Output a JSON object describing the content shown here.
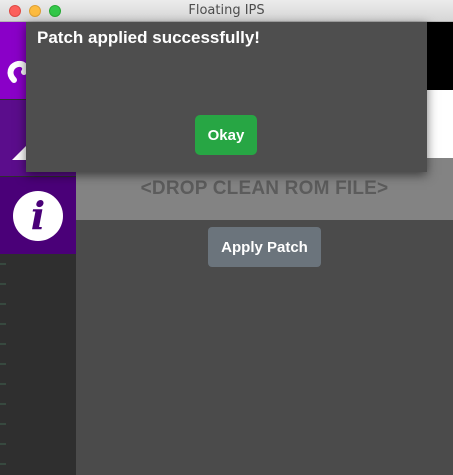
{
  "window": {
    "title": "Floating IPS"
  },
  "sidebar": {
    "items": [
      {
        "name": "apply-patch",
        "icon": "apply-patch-icon",
        "color": "#8a00c8"
      },
      {
        "name": "create-patch",
        "icon": "create-patch-icon",
        "color": "#5b0d8c"
      },
      {
        "name": "info",
        "icon": "info-icon",
        "glyph": "i",
        "color": "#4a0078"
      }
    ]
  },
  "main": {
    "drop_zone_text": "<DROP CLEAN ROM FILE>",
    "apply_patch_label": "Apply Patch"
  },
  "modal": {
    "message": "Patch applied successfully!",
    "okay_label": "Okay"
  },
  "colors": {
    "accent_purple": "#8a00c8",
    "success_green": "#27a644",
    "button_gray": "#6b747c"
  }
}
